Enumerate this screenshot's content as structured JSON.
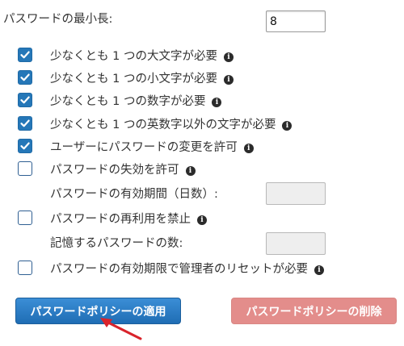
{
  "min_length": {
    "label": "パスワードの最小長:",
    "value": "8"
  },
  "rules": [
    {
      "label": "少なくとも 1 つの大文字が必要",
      "checked": true
    },
    {
      "label": "少なくとも 1 つの小文字が必要",
      "checked": true
    },
    {
      "label": "少なくとも 1 つの数字が必要",
      "checked": true
    },
    {
      "label": "少なくとも 1 つの英数字以外の文字が必要",
      "checked": true
    },
    {
      "label": "ユーザーにパスワードの変更を許可",
      "checked": true
    },
    {
      "label": "パスワードの失効を許可",
      "checked": false
    },
    {
      "label": "パスワードの再利用を禁止",
      "checked": false
    },
    {
      "label": "パスワードの有効期限で管理者のリセットが必要",
      "checked": false
    }
  ],
  "expiration_period": {
    "label": "パスワードの有効期間（日数）:",
    "value": ""
  },
  "remember_count": {
    "label": "記憶するパスワードの数:",
    "value": ""
  },
  "buttons": {
    "apply": "パスワードポリシーの適用",
    "delete": "パスワードポリシーの削除"
  },
  "icons": {
    "info": "info-icon",
    "check": "checkmark-icon",
    "annotation": "red-arrow-icon"
  },
  "colors": {
    "checkbox_checked": "#2577b8",
    "apply_button": "#2a7ec6",
    "delete_button": "#e38d8b",
    "arrow": "#d9232b"
  }
}
